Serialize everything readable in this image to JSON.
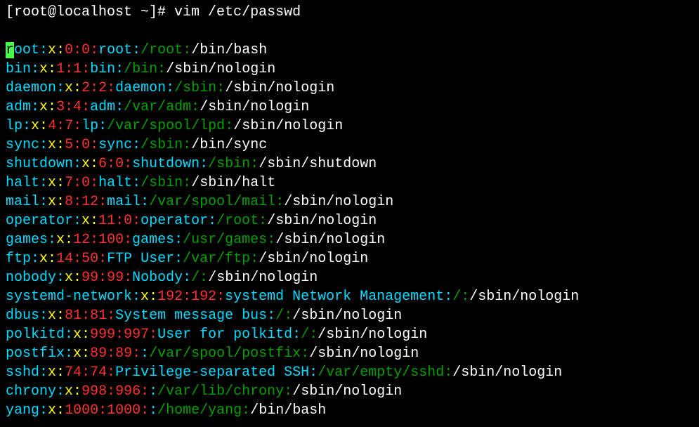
{
  "prompt": "[root@localhost ~]# ",
  "command": "vim /etc/passwd",
  "entries": [
    {
      "user": "root",
      "x": "x",
      "uid": "0",
      "gid": "0",
      "comment": "root",
      "home": "/root",
      "shell": "/bin/bash",
      "cursor": true
    },
    {
      "user": "bin",
      "x": "x",
      "uid": "1",
      "gid": "1",
      "comment": "bin",
      "home": "/bin",
      "shell": "/sbin/nologin"
    },
    {
      "user": "daemon",
      "x": "x",
      "uid": "2",
      "gid": "2",
      "comment": "daemon",
      "home": "/sbin",
      "shell": "/sbin/nologin"
    },
    {
      "user": "adm",
      "x": "x",
      "uid": "3",
      "gid": "4",
      "comment": "adm",
      "home": "/var/adm",
      "shell": "/sbin/nologin"
    },
    {
      "user": "lp",
      "x": "x",
      "uid": "4",
      "gid": "7",
      "comment": "lp",
      "home": "/var/spool/lpd",
      "shell": "/sbin/nologin"
    },
    {
      "user": "sync",
      "x": "x",
      "uid": "5",
      "gid": "0",
      "comment": "sync",
      "home": "/sbin",
      "shell": "/bin/sync"
    },
    {
      "user": "shutdown",
      "x": "x",
      "uid": "6",
      "gid": "0",
      "comment": "shutdown",
      "home": "/sbin",
      "shell": "/sbin/shutdown"
    },
    {
      "user": "halt",
      "x": "x",
      "uid": "7",
      "gid": "0",
      "comment": "halt",
      "home": "/sbin",
      "shell": "/sbin/halt"
    },
    {
      "user": "mail",
      "x": "x",
      "uid": "8",
      "gid": "12",
      "comment": "mail",
      "home": "/var/spool/mail",
      "shell": "/sbin/nologin"
    },
    {
      "user": "operator",
      "x": "x",
      "uid": "11",
      "gid": "0",
      "comment": "operator",
      "home": "/root",
      "shell": "/sbin/nologin"
    },
    {
      "user": "games",
      "x": "x",
      "uid": "12",
      "gid": "100",
      "comment": "games",
      "home": "/usr/games",
      "shell": "/sbin/nologin"
    },
    {
      "user": "ftp",
      "x": "x",
      "uid": "14",
      "gid": "50",
      "comment": "FTP User",
      "home": "/var/ftp",
      "shell": "/sbin/nologin"
    },
    {
      "user": "nobody",
      "x": "x",
      "uid": "99",
      "gid": "99",
      "comment": "Nobody",
      "home": "/",
      "shell": "/sbin/nologin"
    },
    {
      "user": "systemd-network",
      "x": "x",
      "uid": "192",
      "gid": "192",
      "comment": "systemd Network Management",
      "home": "/",
      "shell": "/sbin/nologin"
    },
    {
      "user": "dbus",
      "x": "x",
      "uid": "81",
      "gid": "81",
      "comment": "System message bus",
      "home": "/",
      "shell": "/sbin/nologin"
    },
    {
      "user": "polkitd",
      "x": "x",
      "uid": "999",
      "gid": "997",
      "comment": "User for polkitd",
      "home": "/",
      "shell": "/sbin/nologin"
    },
    {
      "user": "postfix",
      "x": "x",
      "uid": "89",
      "gid": "89",
      "comment": "",
      "home": "/var/spool/postfix",
      "shell": "/sbin/nologin"
    },
    {
      "user": "sshd",
      "x": "x",
      "uid": "74",
      "gid": "74",
      "comment": "Privilege-separated SSH",
      "home": "/var/empty/sshd",
      "shell": "/sbin/nologin"
    },
    {
      "user": "chrony",
      "x": "x",
      "uid": "998",
      "gid": "996",
      "comment": "",
      "home": "/var/lib/chrony",
      "shell": "/sbin/nologin"
    },
    {
      "user": "yang",
      "x": "x",
      "uid": "1000",
      "gid": "1000",
      "comment": "",
      "home": "/home/yang",
      "shell": "/bin/bash"
    }
  ]
}
